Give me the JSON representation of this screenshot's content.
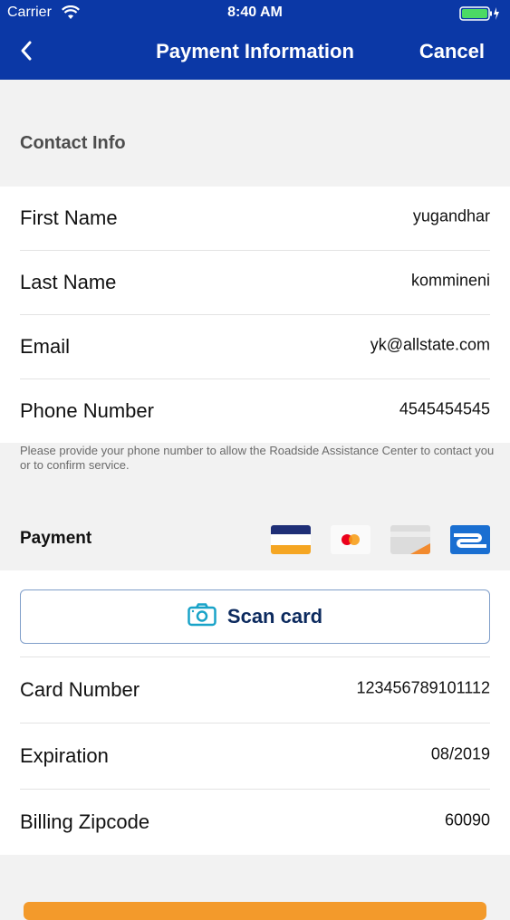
{
  "status_bar": {
    "carrier": "Carrier",
    "time": "8:40 AM"
  },
  "nav": {
    "title": "Payment Information",
    "cancel": "Cancel"
  },
  "contact": {
    "header": "Contact Info",
    "rows": [
      {
        "label": "First Name",
        "value": "yugandhar"
      },
      {
        "label": "Last Name",
        "value": "kommineni"
      },
      {
        "label": "Email",
        "value": "yk@allstate.com"
      },
      {
        "label": "Phone Number",
        "value": "4545454545"
      }
    ],
    "helper": "Please provide your phone number to allow the Roadside Assistance Center to contact you or to confirm service."
  },
  "payment": {
    "header": "Payment",
    "card_icons": [
      "visa-card-icon",
      "mastercard-icon",
      "generic-card-icon",
      "discover-card-icon"
    ],
    "scan_label": "Scan card",
    "rows": [
      {
        "label": "Card Number",
        "value": "123456789101112"
      },
      {
        "label": "Expiration",
        "value": "08/2019"
      },
      {
        "label": "Billing Zipcode",
        "value": "60090"
      }
    ]
  },
  "colors": {
    "nav": "#0b38a6",
    "accent": "#f39a2b"
  }
}
